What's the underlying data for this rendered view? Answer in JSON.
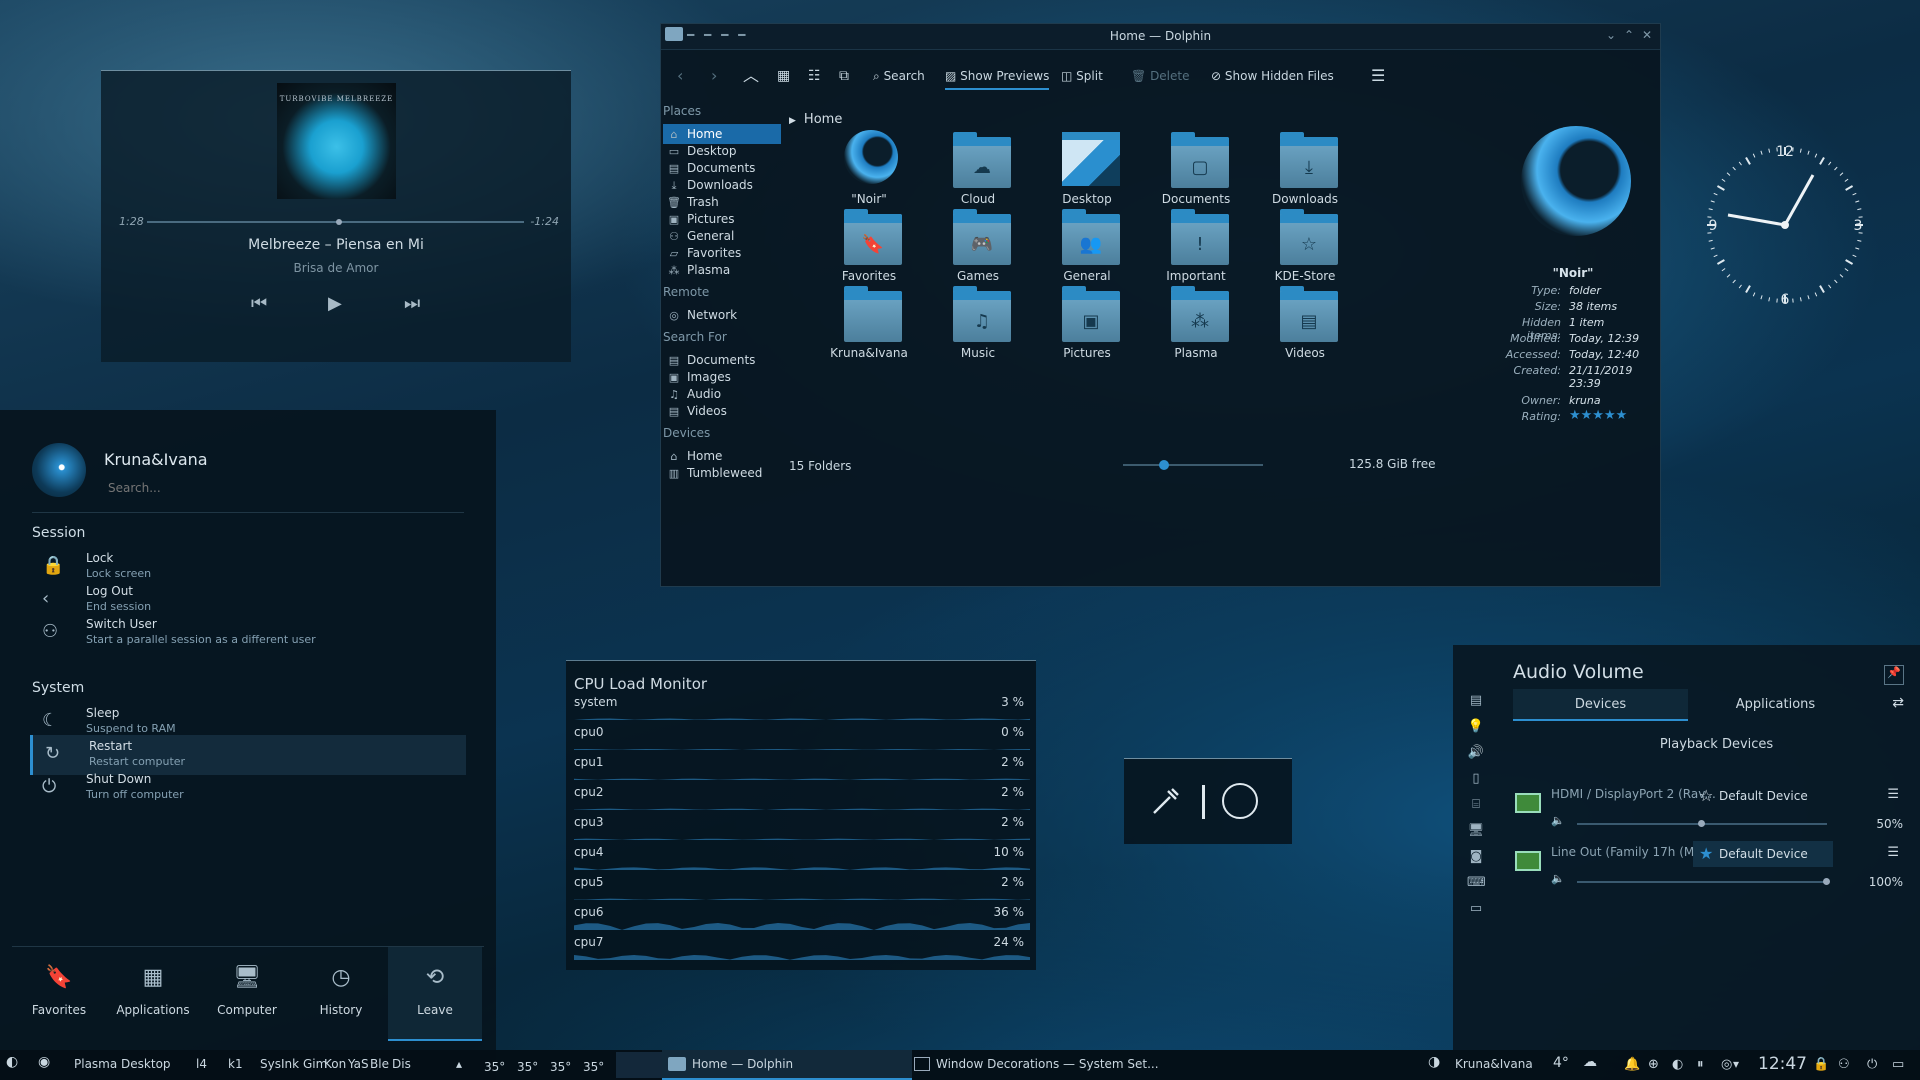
{
  "media": {
    "elapsed": "1:28",
    "remaining": "-1:24",
    "song": "Melbreeze – Piensa en Mi",
    "album": "Brisa de Amor",
    "cover_text": "TURBOVIBE\nMELBREEZE",
    "seek_fraction": 0.51
  },
  "kickoff": {
    "user": "Kruna&Ivana",
    "search_placeholder": "Search...",
    "session_title": "Session",
    "session": [
      {
        "title": "Lock",
        "sub": "Lock screen",
        "icon": "lock-icon"
      },
      {
        "title": "Log Out",
        "sub": "End session",
        "icon": "logout-icon"
      },
      {
        "title": "Switch User",
        "sub": "Start a parallel session as a different user",
        "icon": "switch-user-icon"
      }
    ],
    "system_title": "System",
    "system": [
      {
        "title": "Sleep",
        "sub": "Suspend to RAM",
        "icon": "sleep-icon"
      },
      {
        "title": "Restart",
        "sub": "Restart computer",
        "icon": "restart-icon"
      },
      {
        "title": "Shut Down",
        "sub": "Turn off computer",
        "icon": "shutdown-icon"
      }
    ],
    "tabs": [
      {
        "label": "Favorites",
        "icon": "bookmark-icon"
      },
      {
        "label": "Applications",
        "icon": "grid-icon"
      },
      {
        "label": "Computer",
        "icon": "computer-icon"
      },
      {
        "label": "History",
        "icon": "history-icon"
      },
      {
        "label": "Leave",
        "icon": "leave-icon"
      }
    ]
  },
  "dolphin": {
    "title": "Home — Dolphin",
    "toolbar": {
      "search": "Search",
      "previews": "Show Previews",
      "split": "Split",
      "delete": "Delete",
      "hidden": "Show Hidden Files"
    },
    "places_head": "Places",
    "places": [
      "Home",
      "Desktop",
      "Documents",
      "Downloads",
      "Trash",
      "Pictures",
      "General",
      "Favorites",
      "Plasma"
    ],
    "remote_head": "Remote",
    "remote": [
      "Network"
    ],
    "search_head": "Search For",
    "search": [
      "Documents",
      "Images",
      "Audio",
      "Videos"
    ],
    "devices_head": "Devices",
    "devices": [
      "Home",
      "Tumbleweed"
    ],
    "breadcrumb": "Home",
    "files": [
      {
        "name": "\"Noir\"",
        "glyph": ""
      },
      {
        "name": "Cloud",
        "glyph": "☁"
      },
      {
        "name": "Desktop",
        "glyph": ""
      },
      {
        "name": "Documents",
        "glyph": "▢"
      },
      {
        "name": "Downloads",
        "glyph": "⤓"
      },
      {
        "name": "Favorites",
        "glyph": "🔖"
      },
      {
        "name": "Games",
        "glyph": "🎮"
      },
      {
        "name": "General",
        "glyph": "👥"
      },
      {
        "name": "Important",
        "glyph": "!"
      },
      {
        "name": "KDE-Store",
        "glyph": "☆"
      },
      {
        "name": "Kruna&Ivana",
        "glyph": ""
      },
      {
        "name": "Music",
        "glyph": "♫"
      },
      {
        "name": "Pictures",
        "glyph": "▣"
      },
      {
        "name": "Plasma",
        "glyph": "⁂"
      },
      {
        "name": "Videos",
        "glyph": "▤"
      }
    ],
    "preview": {
      "name": "\"Noir\"",
      "rows": [
        [
          "Type:",
          "folder"
        ],
        [
          "Size:",
          "38 items"
        ],
        [
          "Hidden items:",
          "1 item"
        ],
        [
          "Modified:",
          "Today, 12:39"
        ],
        [
          "Accessed:",
          "Today, 12:40"
        ],
        [
          "Created:",
          "21/11/2019 23:39"
        ],
        [
          "Owner:",
          "kruna"
        ],
        [
          "Rating:",
          "★★★★★"
        ]
      ]
    },
    "status": "15 Folders",
    "free": "125.8 GiB free"
  },
  "cpu": {
    "title": "CPU Load Monitor",
    "rows": [
      {
        "name": "system",
        "value": "3 %"
      },
      {
        "name": "cpu0",
        "value": "0 %"
      },
      {
        "name": "cpu1",
        "value": "2 %"
      },
      {
        "name": "cpu2",
        "value": "2 %"
      },
      {
        "name": "cpu3",
        "value": "2 %"
      },
      {
        "name": "cpu4",
        "value": "10 %"
      },
      {
        "name": "cpu5",
        "value": "2 %"
      },
      {
        "name": "cpu6",
        "value": "36 %"
      },
      {
        "name": "cpu7",
        "value": "24 %"
      }
    ]
  },
  "audio": {
    "title": "Audio Volume",
    "tab_devices": "Devices",
    "tab_apps": "Applications",
    "section": "Playback Devices",
    "devices": [
      {
        "name": "HDMI / DisplayPort 2 (Rav...",
        "default": "Default Device",
        "percent": "50%",
        "volume": 0.5,
        "is_default": false
      },
      {
        "name": "Line Out (Family 17h (Mod...",
        "default": "Default Device",
        "percent": "100%",
        "volume": 1.0,
        "is_default": true
      }
    ]
  },
  "taskbar": {
    "activity": "Plasma Desktop",
    "quick": [
      "l4",
      "k1",
      "Sys",
      "Ink",
      "Gim",
      "Kon",
      "YaS",
      "Ble",
      "Dis"
    ],
    "temps": [
      "35°",
      "35°",
      "35°",
      "35°"
    ],
    "task1": "Home — Dolphin",
    "task2": "Window Decorations — System Set...",
    "user": "Kruna&Ivana",
    "weather": "4°",
    "time": "12:47"
  },
  "colors": {
    "accent": "#2d8fd0",
    "selection": "#1a6aa8"
  }
}
